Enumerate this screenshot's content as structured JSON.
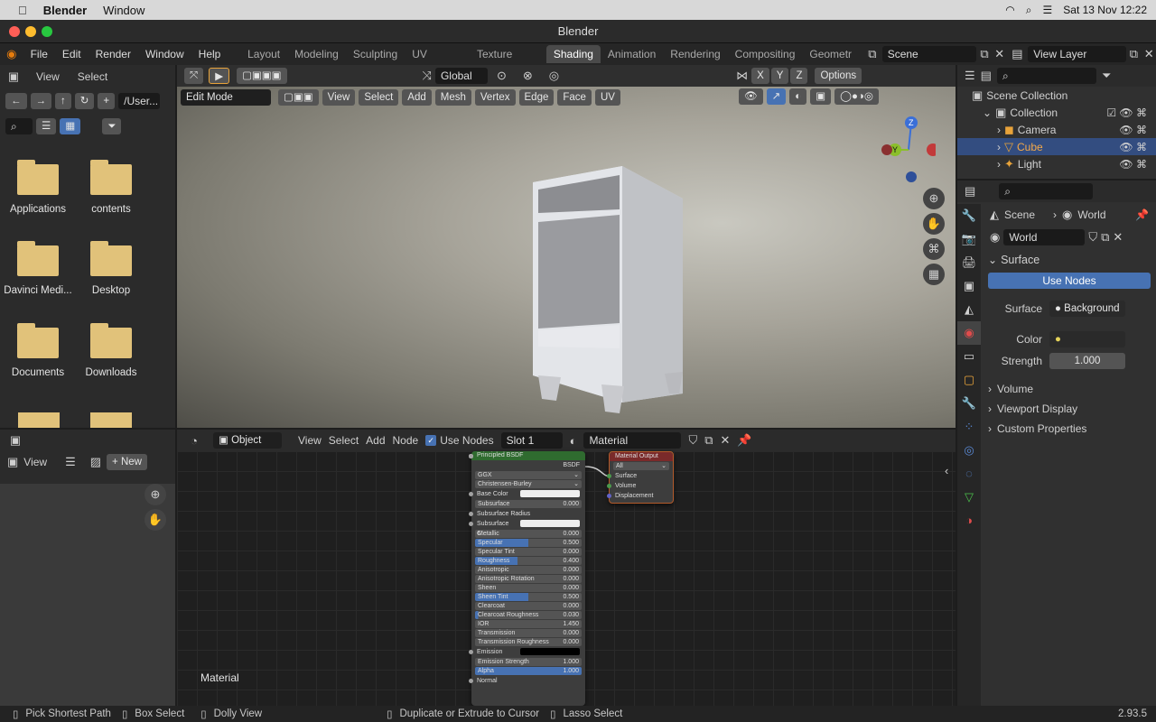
{
  "macos": {
    "app_name": "Blender",
    "menu_window": "Window",
    "date_time": "Sat 13 Nov  12:22"
  },
  "window_title": "Blender",
  "topbar": {
    "menus": [
      "File",
      "Edit",
      "Render",
      "Window",
      "Help"
    ],
    "workspaces": [
      "Layout",
      "Modeling",
      "Sculpting",
      "UV Editing",
      "Texture Paint",
      "Shading",
      "Animation",
      "Rendering",
      "Compositing",
      "Geometr"
    ],
    "active_workspace": "Shading",
    "scene": "Scene",
    "view_layer": "View Layer"
  },
  "filebrowser": {
    "menus": [
      "View",
      "Select"
    ],
    "path": "/User...",
    "folders": [
      "Applications",
      "contents",
      "Davinci Medi...",
      "Desktop",
      "Documents",
      "Downloads"
    ]
  },
  "viewport": {
    "transform": "Global",
    "options": "Options",
    "mode": "Edit Mode",
    "menus": [
      "View",
      "Select",
      "Add",
      "Mesh",
      "Vertex",
      "Edge",
      "Face",
      "UV"
    ],
    "axes": [
      "X",
      "Y",
      "Z"
    ]
  },
  "image_editor": {
    "view": "View",
    "new_label": "New"
  },
  "node_editor": {
    "object_mode": "Object",
    "menus": [
      "View",
      "Select",
      "Add",
      "Node"
    ],
    "use_nodes": "Use Nodes",
    "slot": "Slot 1",
    "material": "Material",
    "area_label": "Material",
    "bsdf": {
      "title": "Principled BSDF",
      "output": "BSDF",
      "distribution": "GGX",
      "subsurface_method": "Christensen-Burley",
      "rows": [
        {
          "label": "Base Color",
          "value": "",
          "fill": 0
        },
        {
          "label": "Subsurface",
          "value": "0.000",
          "fill": 0
        },
        {
          "label": "Subsurface Radius",
          "value": "",
          "fill": 0
        },
        {
          "label": "Subsurface C...",
          "value": "",
          "fill": 0
        },
        {
          "label": "Metallic",
          "value": "0.000",
          "fill": 0
        },
        {
          "label": "Specular",
          "value": "0.500",
          "fill": 0.5
        },
        {
          "label": "Specular Tint",
          "value": "0.000",
          "fill": 0
        },
        {
          "label": "Roughness",
          "value": "0.400",
          "fill": 0.4
        },
        {
          "label": "Anisotropic",
          "value": "0.000",
          "fill": 0
        },
        {
          "label": "Anisotropic Rotation",
          "value": "0.000",
          "fill": 0
        },
        {
          "label": "Sheen",
          "value": "0.000",
          "fill": 0
        },
        {
          "label": "Sheen Tint",
          "value": "0.500",
          "fill": 0.5
        },
        {
          "label": "Clearcoat",
          "value": "0.000",
          "fill": 0
        },
        {
          "label": "Clearcoat Roughness",
          "value": "0.030",
          "fill": 0.03
        },
        {
          "label": "IOR",
          "value": "1.450",
          "fill": 0
        },
        {
          "label": "Transmission",
          "value": "0.000",
          "fill": 0
        },
        {
          "label": "Transmission Roughness",
          "value": "0.000",
          "fill": 0
        },
        {
          "label": "Emission",
          "value": "",
          "fill": 0
        },
        {
          "label": "Emission Strength",
          "value": "1.000",
          "fill": 0
        },
        {
          "label": "Alpha",
          "value": "1.000",
          "fill": 1
        },
        {
          "label": "Normal",
          "value": "",
          "fill": 0
        }
      ]
    },
    "output": {
      "title": "Material Output",
      "target": "All",
      "inputs": [
        "Surface",
        "Volume",
        "Displacement"
      ]
    }
  },
  "outliner": {
    "root": "Scene Collection",
    "collection": "Collection",
    "items": [
      "Camera",
      "Cube",
      "Light"
    ]
  },
  "properties": {
    "breadcrumb_scene": "Scene",
    "breadcrumb_world": "World",
    "world_name": "World",
    "surface_section": "Surface",
    "use_nodes": "Use Nodes",
    "surface_label": "Surface",
    "surface_value": "Background",
    "color_label": "Color",
    "strength_label": "Strength",
    "strength_value": "1.000",
    "sections": [
      "Volume",
      "Viewport Display",
      "Custom Properties"
    ]
  },
  "statusbar": {
    "items": [
      "Pick Shortest Path",
      "Box Select",
      "Dolly View",
      "Duplicate or Extrude to Cursor",
      "Lasso Select"
    ],
    "version": "2.93.5"
  },
  "colors": {
    "accent": "#4772b3",
    "bsdf_header": "#2f6b2f",
    "output_header": "#7a2a2a"
  }
}
